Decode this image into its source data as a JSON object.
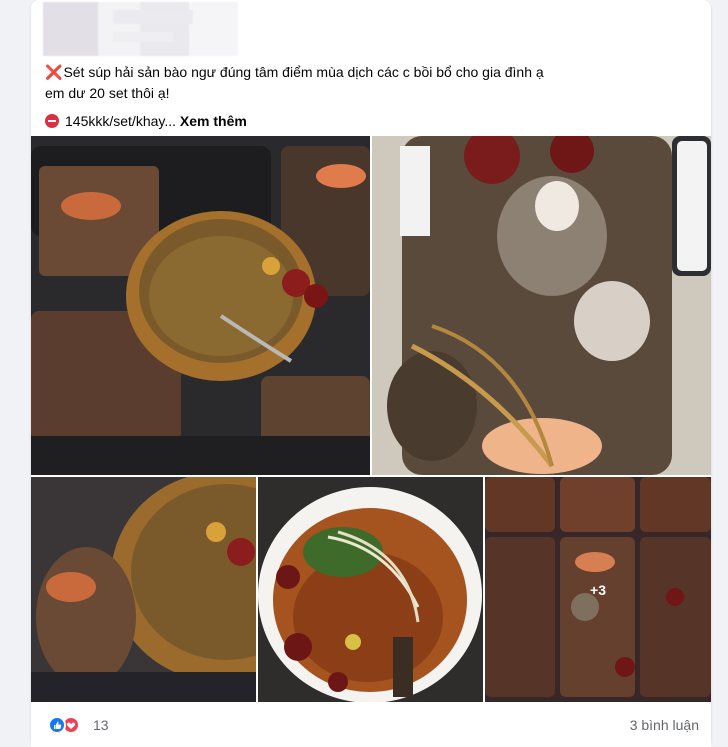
{
  "post": {
    "line1_mark": "❌",
    "line1": "Sét súp hải sản bào ngư đúng tâm điểm mùa dịch các c bồi bổ cho gia đình ạ",
    "line2": "em dư 20 set thôi ạ!",
    "price_text": "145kkk/set/khay...",
    "see_more": "Xem thêm"
  },
  "gallery": {
    "more_count": "+3"
  },
  "footer": {
    "reaction_count": "13",
    "comment_count": "3 bình luận"
  },
  "icons": {
    "reactions": [
      "like-icon",
      "love-icon"
    ],
    "price_icon": "no-entry-icon"
  },
  "colors": {
    "like": "#1877f2",
    "love": "#f33e58",
    "text": "#050505",
    "muted": "#65676b"
  }
}
